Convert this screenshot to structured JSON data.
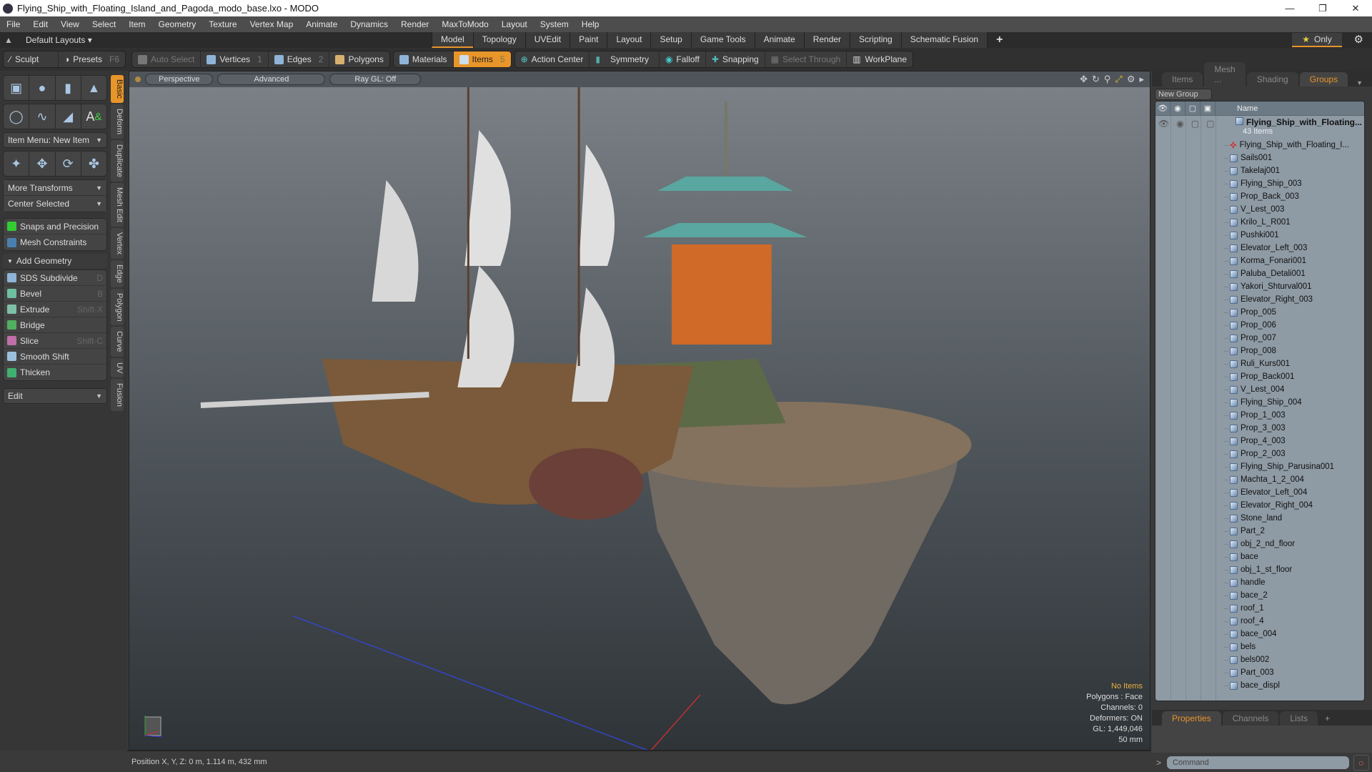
{
  "window": {
    "title": "Flying_Ship_with_Floating_Island_and_Pagoda_modo_base.lxo - MODO",
    "controls": [
      "minimize",
      "restore",
      "close"
    ]
  },
  "menu": [
    "File",
    "Edit",
    "View",
    "Select",
    "Item",
    "Geometry",
    "Texture",
    "Vertex Map",
    "Animate",
    "Dynamics",
    "Render",
    "MaxToModo",
    "Layout",
    "System",
    "Help"
  ],
  "layout_bar": {
    "layouts_label": "Default Layouts ▾",
    "tabs": [
      "Model",
      "Topology",
      "UVEdit",
      "Paint",
      "Layout",
      "Setup",
      "Game Tools",
      "Animate",
      "Render",
      "Scripting",
      "Schematic Fusion"
    ],
    "active_tab": "Model",
    "only_label": "Only"
  },
  "toolbar": {
    "sculpt": "Sculpt",
    "presets": "Presets",
    "presets_key": "F6",
    "auto_select": "Auto Select",
    "vertices": "Vertices",
    "vertices_key": "1",
    "edges": "Edges",
    "edges_key": "2",
    "polygons": "Polygons",
    "materials": "Materials",
    "items": "Items",
    "items_key": "5",
    "action_center": "Action Center",
    "symmetry": "Symmetry",
    "falloff": "Falloff",
    "snapping": "Snapping",
    "select_through": "Select Through",
    "workplane": "WorkPlane"
  },
  "left_panel": {
    "item_menu": "Item Menu: New Item",
    "more_transforms": "More Transforms",
    "center_selected": "Center Selected",
    "snaps": "Snaps and Precision",
    "mesh_constraints": "Mesh Constraints",
    "add_geometry": "Add Geometry",
    "tools": [
      {
        "label": "SDS Subdivide",
        "key": "D",
        "color": "#8fb4d8"
      },
      {
        "label": "Bevel",
        "key": "B",
        "color": "#6fc0a0"
      },
      {
        "label": "Extrude",
        "key": "Shift-X",
        "color": "#7fbfa8"
      },
      {
        "label": "Bridge",
        "key": "",
        "color": "#50b060"
      },
      {
        "label": "Slice",
        "key": "Shift-C",
        "color": "#c070a8"
      },
      {
        "label": "Smooth Shift",
        "key": "",
        "color": "#9cc0dc"
      },
      {
        "label": "Thicken",
        "key": "",
        "color": "#40b070"
      }
    ],
    "edit_dropdown": "Edit",
    "vertical_tabs": [
      "Basic",
      "Deform",
      "Duplicate",
      "Mesh Edit",
      "Vertex",
      "Edge",
      "Polygon",
      "Curve",
      "UV",
      "Fusion"
    ],
    "active_vertical_tab": "Basic"
  },
  "viewport": {
    "view_mode": "Perspective",
    "shading": "Advanced",
    "raygl": "Ray GL: Off",
    "info": {
      "selection": "No Items",
      "polygons": "Polygons : Face",
      "channels": "Channels: 0",
      "deformers": "Deformers: ON",
      "gl": "GL: 1,449,046",
      "scale": "50 mm"
    }
  },
  "status": {
    "position": "Position X, Y, Z:   0 m, 1.114 m, 432 mm"
  },
  "right_panel": {
    "tabs": [
      "Items",
      "Mesh ...",
      "Shading",
      "Groups"
    ],
    "active_tab": "Groups",
    "new_group": "New Group",
    "name_header": "Name",
    "root": {
      "name": "Flying_Ship_with_Floating...",
      "count": "43 Items"
    },
    "locator": "Flying_Ship_with_Floating_I...",
    "items": [
      "Sails001",
      "Takelaj001",
      "Flying_Ship_003",
      "Prop_Back_003",
      "V_Lest_003",
      "Krilo_L_R001",
      "Pushki001",
      "Elevator_Left_003",
      "Korma_Fonari001",
      "Paluba_Detali001",
      "Yakori_Shturval001",
      "Elevator_Right_003",
      "Prop_005",
      "Prop_006",
      "Prop_007",
      "Prop_008",
      "Ruli_Kurs001",
      "Prop_Back001",
      "V_Lest_004",
      "Flying_Ship_004",
      "Prop_1_003",
      "Prop_3_003",
      "Prop_4_003",
      "Prop_2_003",
      "Flying_Ship_Parusina001",
      "Machta_1_2_004",
      "Elevator_Left_004",
      "Elevator_Right_004",
      "Stone_land",
      "Part_2",
      "obj_2_nd_floor",
      "bace",
      "obj_1_st_floor",
      "handle",
      "bace_2",
      "roof_1",
      "roof_4",
      "bace_004",
      "bels",
      "bels002",
      "Part_003",
      "bace_displ"
    ],
    "bottom_tabs": [
      "Properties",
      "Channels",
      "Lists"
    ],
    "active_bottom_tab": "Properties",
    "command_placeholder": "Command"
  }
}
